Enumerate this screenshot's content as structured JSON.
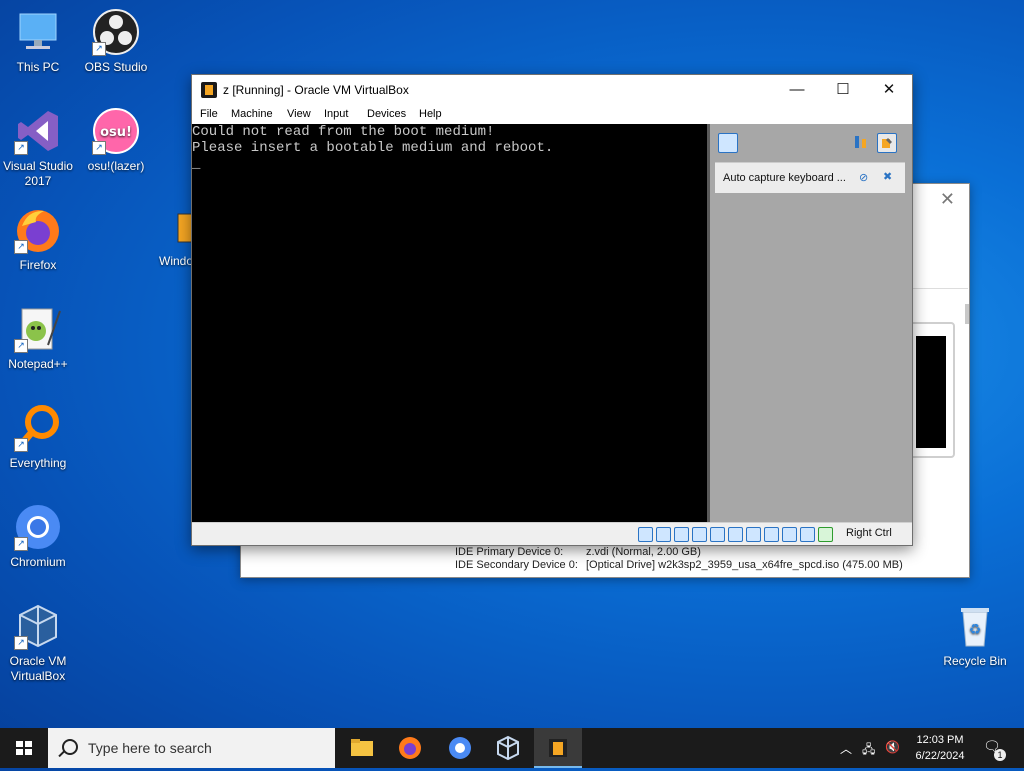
{
  "desktop": {
    "icons": [
      {
        "label": "This PC"
      },
      {
        "label": "OBS Studio"
      },
      {
        "label": "Visual Studio 2017"
      },
      {
        "label": "osu!(lazer)"
      },
      {
        "label": "Firefox"
      },
      {
        "label": "Windo"
      },
      {
        "label": "Notepad++"
      },
      {
        "label": "Everything"
      },
      {
        "label": "Chromium"
      },
      {
        "label": "Oracle VM VirtualBox"
      },
      {
        "label": "Recycle Bin"
      }
    ],
    "osu_badge": "osu!"
  },
  "manager": {
    "close_glyph": "✕",
    "details": [
      {
        "key": "IDE Primary Device 0:",
        "value": "z.vdi (Normal, 2.00 GB)"
      },
      {
        "key": "IDE Secondary Device 0:",
        "value": "[Optical Drive] w2k3sp2_3959_usa_x64fre_spcd.iso (475.00 MB)"
      }
    ]
  },
  "vm_window": {
    "title": "z [Running] - Oracle VM VirtualBox",
    "controls": {
      "minimize": "—",
      "maximize": "☐",
      "close": "✕"
    },
    "menu": [
      "File",
      "Machine",
      "View",
      "Input",
      "Devices",
      "Help"
    ],
    "console_text": "Could not read from the boot medium!\nPlease insert a bootable medium and reboot.\n_",
    "notice_text": "Auto capture keyboard ...",
    "host_key": "Right Ctrl"
  },
  "taskbar": {
    "search_placeholder": "Type here to search",
    "time": "12:03 PM",
    "date": "6/22/2024",
    "notification_count": "1"
  },
  "colors": {
    "accent": "#2a73c4",
    "taskbar": "#1b1b1b",
    "console_text": "#c8c8c8"
  }
}
